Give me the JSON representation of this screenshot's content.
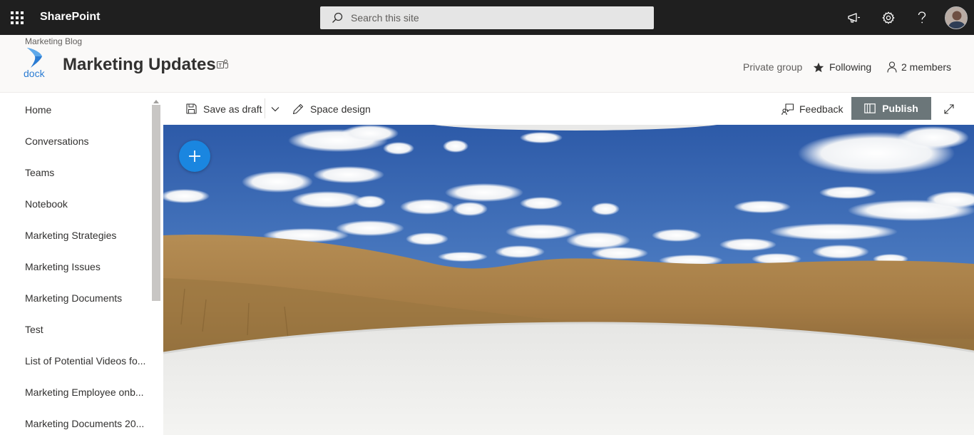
{
  "suite": {
    "brand": "SharePoint",
    "search_placeholder": "Search this site"
  },
  "site": {
    "breadcrumb": "Marketing Blog",
    "logo_text": "dock",
    "title": "Marketing Updates",
    "privacy": "Private group",
    "follow_label": "Following",
    "members_label": "2 members"
  },
  "nav": {
    "items": [
      {
        "label": "Home"
      },
      {
        "label": "Conversations"
      },
      {
        "label": "Teams"
      },
      {
        "label": "Notebook"
      },
      {
        "label": "Marketing Strategies"
      },
      {
        "label": "Marketing Issues"
      },
      {
        "label": "Marketing Documents"
      },
      {
        "label": "Test"
      },
      {
        "label": "List of Potential Videos fo..."
      },
      {
        "label": "Marketing Employee onb..."
      },
      {
        "label": "Marketing Documents 20..."
      }
    ]
  },
  "commands": {
    "save_draft": "Save as draft",
    "space_design": "Space design",
    "feedback": "Feedback",
    "publish": "Publish"
  },
  "colors": {
    "suitebar": "#1f1f1f",
    "publish_button": "#6b7679",
    "add_button": "#1a86e0",
    "logo_blue": "#2b7cd3"
  },
  "icons": [
    "waffle-icon",
    "search-icon",
    "megaphone-icon",
    "gear-icon",
    "help-icon",
    "teams-icon",
    "star-icon",
    "person-icon",
    "save-icon",
    "chevron-down-icon",
    "pencil-icon",
    "feedback-icon",
    "book-icon",
    "expand-icon",
    "plus-icon"
  ]
}
